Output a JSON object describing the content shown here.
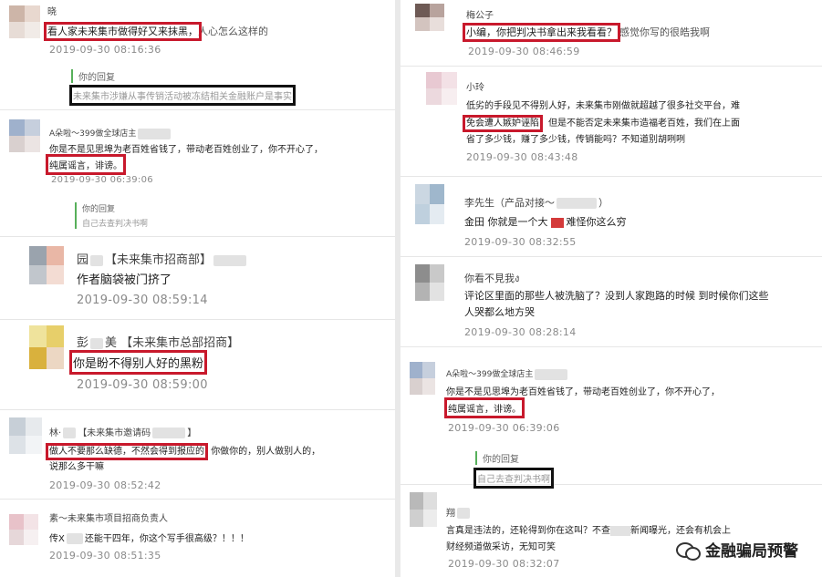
{
  "left": {
    "c1": {
      "name": "晓",
      "text_hl": "看人家未来集市做得好又来抹黑，",
      "text_rest": "人心怎么这样的",
      "time": "2019-09-30 08:16:36",
      "reply_label": "你的回复",
      "reply_text": "未来集市涉嫌从事传销活动被冻结相关金融账户是事实"
    },
    "c2": {
      "name": "A朵啦～399做全球店主",
      "line1": "你是不是见思埠为老百姓省钱了，带动老百姓创业了，你不开心了，",
      "line2_hl": "纯属谣言，诽谤。",
      "time": "2019-09-30 06:39:06",
      "reply_label": "你的回复",
      "reply_text": "自己去查判决书啊"
    },
    "c3": {
      "name_a": "园",
      "name_b": "【未来集市招商部】",
      "text": "作者脑袋被门挤了",
      "time": "2019-09-30 08:59:14"
    },
    "c4": {
      "name_a": "彭",
      "name_b": "美 【未来集市总部招商】",
      "text_hl": "你是盼不得别人好的黑粉",
      "time": "2019-09-30 08:59:00"
    },
    "c5": {
      "name_a": "林·",
      "name_b": "【未来集市邀请码",
      "name_c": "】",
      "text_hl": "做人不要那么缺德，不然会得到报应的",
      "text_rest": "你做你的，别人做别人的，",
      "line2": "说那么多干嘛",
      "time": "2019-09-30 08:52:42"
    },
    "c6": {
      "name": "素～未来集市项目招商负责人",
      "text_a": "传X",
      "text_b": "还能干四年，你这个写手很高级？！！！",
      "time": "2019-09-30 08:51:35"
    }
  },
  "right": {
    "c1": {
      "name": "梅公子",
      "text_hl": "小编，你把判决书拿出来我看看？",
      "text_rest": "感觉你写的很皓我啊",
      "time": "2019-09-30 08:46:59"
    },
    "c2": {
      "name": "小玲",
      "line1": "低劣的手段见不得别人好，未来集市刚做就超越了很多社交平台，难",
      "line2_hl": "免会遭人嫉妒诬陷",
      "line2_rest": "，但是不能否定未来集市造福老百姓，我们在上面",
      "line3": "省了多少钱，赚了多少钱，传销能吗？不知道别胡咧咧",
      "time": "2019-09-30 08:43:48"
    },
    "c3": {
      "name_a": "李先生（产品对接～",
      "name_b": "）",
      "text": "金田 你就是一个大",
      "text_b": "难怪你这么穷",
      "time": "2019-09-30 08:32:55"
    },
    "c4": {
      "name": "你看不見我ง",
      "line1": "评论区里面的那些人被洗脑了？没到人家跑路的时候 到时候你们这些",
      "line2": "人哭都么地方哭",
      "time": "2019-09-30 08:28:14"
    },
    "c5": {
      "name": "A朵啦～399做全球店主",
      "line1": "你是不是见思埠为老百姓省钱了，带动老百姓创业了，你不开心了，",
      "line2_hl": "纯属谣言，诽谤。",
      "time": "2019-09-30 06:39:06",
      "reply_label": "你的回复",
      "reply_text": "自己去查判决书啊"
    },
    "c6": {
      "name": "翔",
      "line1": "言真是违法的，还轮得到你在这叫？不查",
      "line1_b": "新闻曝光，还会有机会上",
      "line2": "财经频道做采访，无知可笑",
      "time": "2019-09-30 08:32:07"
    }
  },
  "watermark": {
    "text": "金融骗局预警",
    "icon": "wechat-icon"
  }
}
